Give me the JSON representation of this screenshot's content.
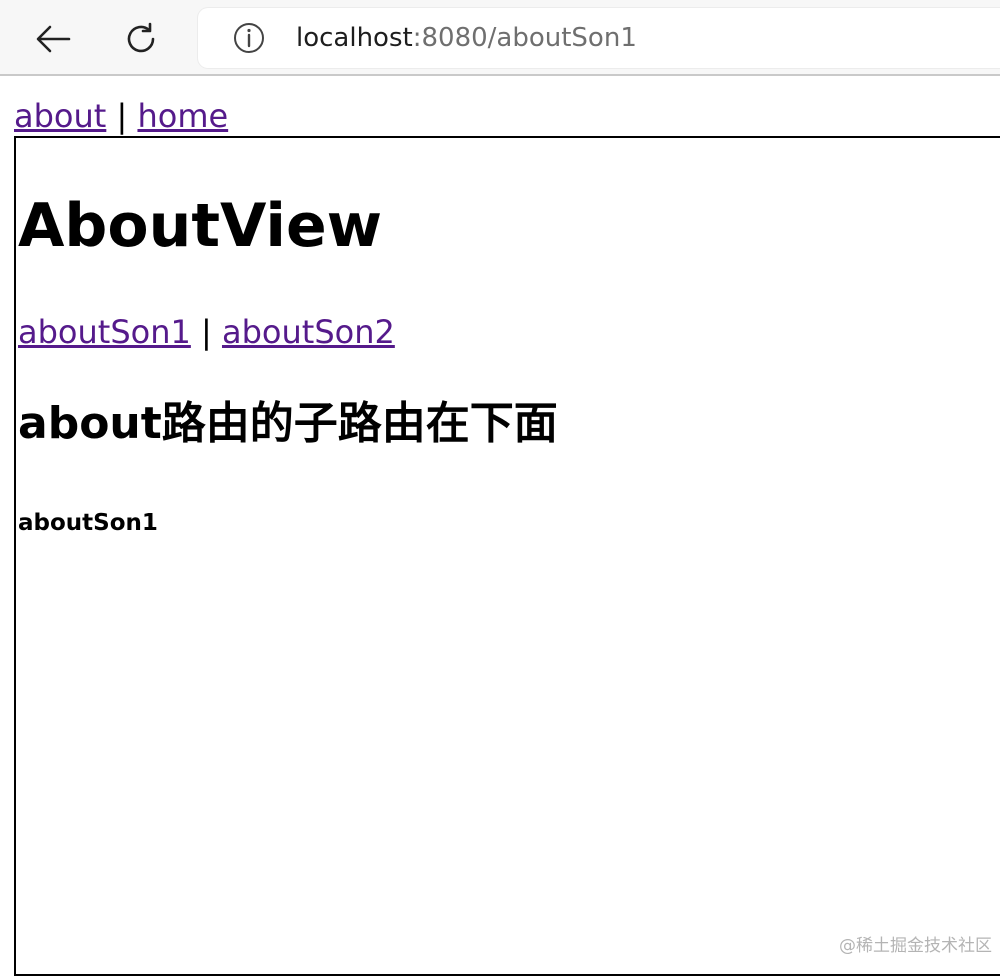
{
  "browser": {
    "url_host": "localhost",
    "url_path": ":8080/aboutSon1",
    "icons": {
      "back": "arrow-left-icon",
      "reload": "reload-icon",
      "site_info": "info-circle-icon"
    }
  },
  "top_nav": {
    "about": "about",
    "separator": "|",
    "home": "home"
  },
  "about_view": {
    "title": "AboutView",
    "sub_nav": {
      "son1": "aboutSon1",
      "separator": "|",
      "son2": "aboutSon2"
    },
    "child_heading": "about路由的子路由在下面",
    "child_content": "aboutSon1"
  },
  "watermark": "@稀土掘金技术社区",
  "colors": {
    "link": "#551a8b",
    "toolbar": "#f7f7f7",
    "border": "#000000"
  }
}
